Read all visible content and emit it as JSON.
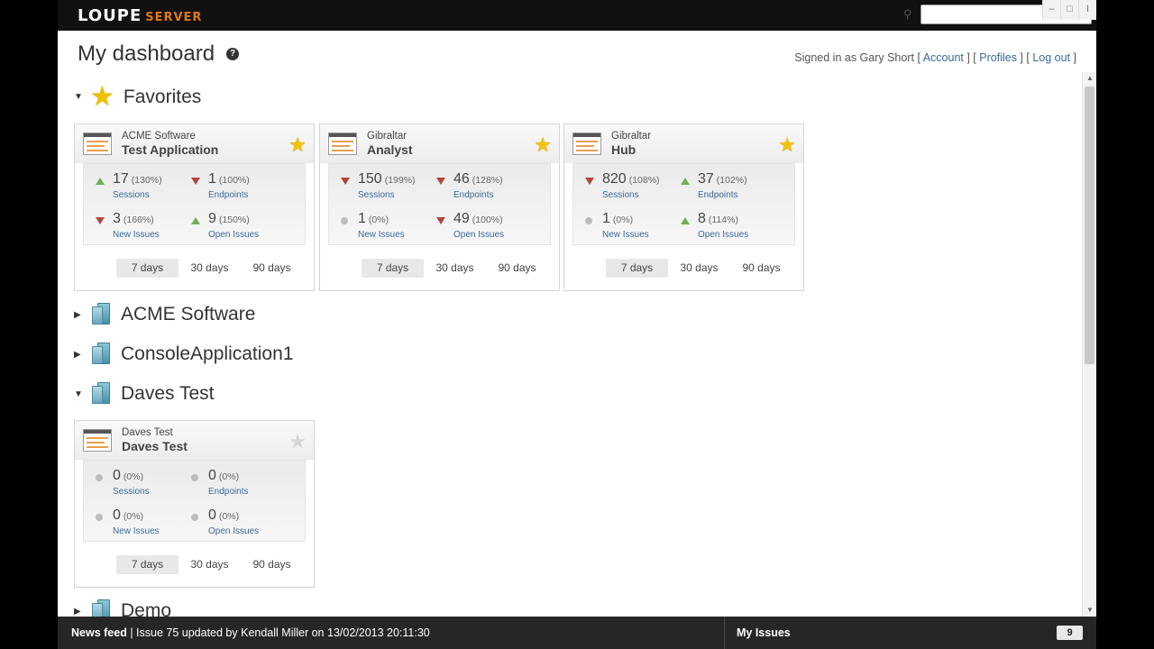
{
  "topbar": {
    "logo_main": "LOUPE",
    "logo_sub": "SERVER",
    "search_placeholder": "",
    "win_min": "–",
    "win_max": "□",
    "win_close": "I"
  },
  "header": {
    "title": "My dashboard",
    "help": "?",
    "signed_in_prefix": "Signed in as Gary Short",
    "account": "Account",
    "profiles": "Profiles",
    "logout": "Log out"
  },
  "sections": {
    "favorites": {
      "title": "Favorites",
      "expanded": true
    },
    "acme": {
      "title": "ACME Software",
      "expanded": false
    },
    "console": {
      "title": "ConsoleApplication1",
      "expanded": false
    },
    "daves": {
      "title": "Daves Test",
      "expanded": true
    },
    "demo": {
      "title": "Demo",
      "expanded": false
    }
  },
  "cards": [
    {
      "org": "ACME Software",
      "name": "Test Application",
      "favorite": true,
      "stats": [
        {
          "value": "17",
          "pct": "(130%)",
          "label": "Sessions",
          "trend": "up"
        },
        {
          "value": "1",
          "pct": "(100%)",
          "label": "Endpoints",
          "trend": "down"
        },
        {
          "value": "3",
          "pct": "(166%)",
          "label": "New Issues",
          "trend": "down"
        },
        {
          "value": "9",
          "pct": "(150%)",
          "label": "Open Issues",
          "trend": "up"
        }
      ],
      "periods": [
        "7 days",
        "30 days",
        "90 days"
      ],
      "active_period": "7 days"
    },
    {
      "org": "Gibraltar",
      "name": "Analyst",
      "favorite": true,
      "stats": [
        {
          "value": "150",
          "pct": "(199%)",
          "label": "Sessions",
          "trend": "down"
        },
        {
          "value": "46",
          "pct": "(128%)",
          "label": "Endpoints",
          "trend": "down"
        },
        {
          "value": "1",
          "pct": "(0%)",
          "label": "New Issues",
          "trend": "flat"
        },
        {
          "value": "49",
          "pct": "(100%)",
          "label": "Open Issues",
          "trend": "down"
        }
      ],
      "periods": [
        "7 days",
        "30 days",
        "90 days"
      ],
      "active_period": "7 days"
    },
    {
      "org": "Gibraltar",
      "name": "Hub",
      "favorite": true,
      "stats": [
        {
          "value": "820",
          "pct": "(108%)",
          "label": "Sessions",
          "trend": "down"
        },
        {
          "value": "37",
          "pct": "(102%)",
          "label": "Endpoints",
          "trend": "up"
        },
        {
          "value": "1",
          "pct": "(0%)",
          "label": "New Issues",
          "trend": "flat"
        },
        {
          "value": "8",
          "pct": "(114%)",
          "label": "Open Issues",
          "trend": "up"
        }
      ],
      "periods": [
        "7 days",
        "30 days",
        "90 days"
      ],
      "active_period": "7 days"
    },
    {
      "org": "Daves Test",
      "name": "Daves Test",
      "favorite": false,
      "stats": [
        {
          "value": "0",
          "pct": "(0%)",
          "label": "Sessions",
          "trend": "flat"
        },
        {
          "value": "0",
          "pct": "(0%)",
          "label": "Endpoints",
          "trend": "flat"
        },
        {
          "value": "0",
          "pct": "(0%)",
          "label": "New Issues",
          "trend": "flat"
        },
        {
          "value": "0",
          "pct": "(0%)",
          "label": "Open Issues",
          "trend": "flat"
        }
      ],
      "periods": [
        "7 days",
        "30 days",
        "90 days"
      ],
      "active_period": "7 days"
    }
  ],
  "footer": {
    "news_label": "News feed",
    "news_text": "| Issue 75 updated by Kendall Miller on 13/02/2013 20:11:30",
    "my_issues": "My Issues",
    "issue_count": "9"
  },
  "colors": {
    "up": "#6fae58",
    "down": "#b3463c",
    "flat": "#bdbdbd",
    "star": "#f4c400",
    "link": "#3a6a9a"
  }
}
